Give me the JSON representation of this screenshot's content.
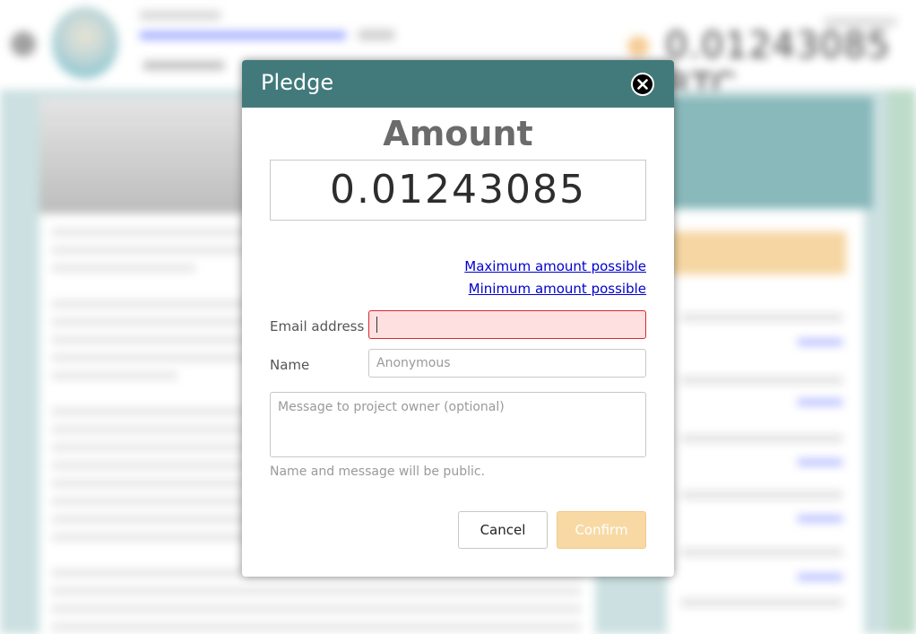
{
  "background": {
    "big_number": "0.01243085 BTC"
  },
  "modal": {
    "title": "Pledge",
    "amount_label": "Amount",
    "amount_value": "0.01243085",
    "max_link": "Maximum amount possible",
    "min_link": "Minimum amount possible",
    "email_label": "Email address",
    "email_value": "",
    "name_label": "Name",
    "name_placeholder": "Anonymous",
    "message_placeholder": "Message to project owner (optional)",
    "public_note": "Name and message will be public.",
    "cancel_label": "Cancel",
    "confirm_label": "Confirm"
  },
  "colors": {
    "header_bg": "#427a7c",
    "email_error_bg": "#ffe0e0",
    "email_error_border": "#d9282f",
    "confirm_bg": "#f8d9a4",
    "link": "#0000cc"
  },
  "icons": {
    "close": "close-icon"
  }
}
